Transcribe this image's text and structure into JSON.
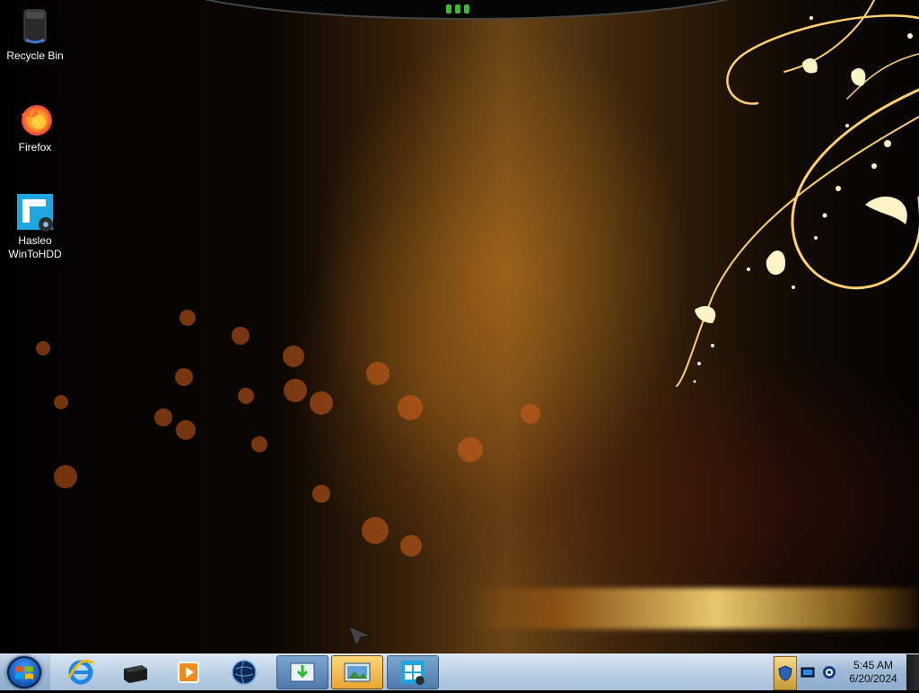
{
  "desktop": {
    "icons": [
      {
        "label": "Recycle Bin",
        "icon": "recycle-bin-icon"
      },
      {
        "label": "Firefox",
        "icon": "firefox-icon"
      },
      {
        "label_line1": "Hasleo",
        "label_line2": "WinToHDD",
        "icon": "wintohdd-icon"
      }
    ]
  },
  "taskbar": {
    "start_icon": "windows-orb-icon",
    "pinned": [
      {
        "icon": "internet-explorer-icon"
      },
      {
        "icon": "device-icon"
      },
      {
        "icon": "media-player-icon"
      },
      {
        "icon": "globe-icon"
      },
      {
        "icon": "download-window-icon",
        "state": "running"
      },
      {
        "icon": "picture-window-icon",
        "state": "active"
      },
      {
        "icon": "windows-setup-icon",
        "state": "running"
      }
    ],
    "tray_icons": [
      "security-shield-icon",
      "network-icon",
      "update-icon"
    ],
    "clock": {
      "time": "5:45 AM",
      "date": "6/20/2024"
    }
  },
  "colors": {
    "taskbar": "#a8c0db",
    "accent_gold": "#ffcc55",
    "led_green": "#3cbc2c"
  }
}
